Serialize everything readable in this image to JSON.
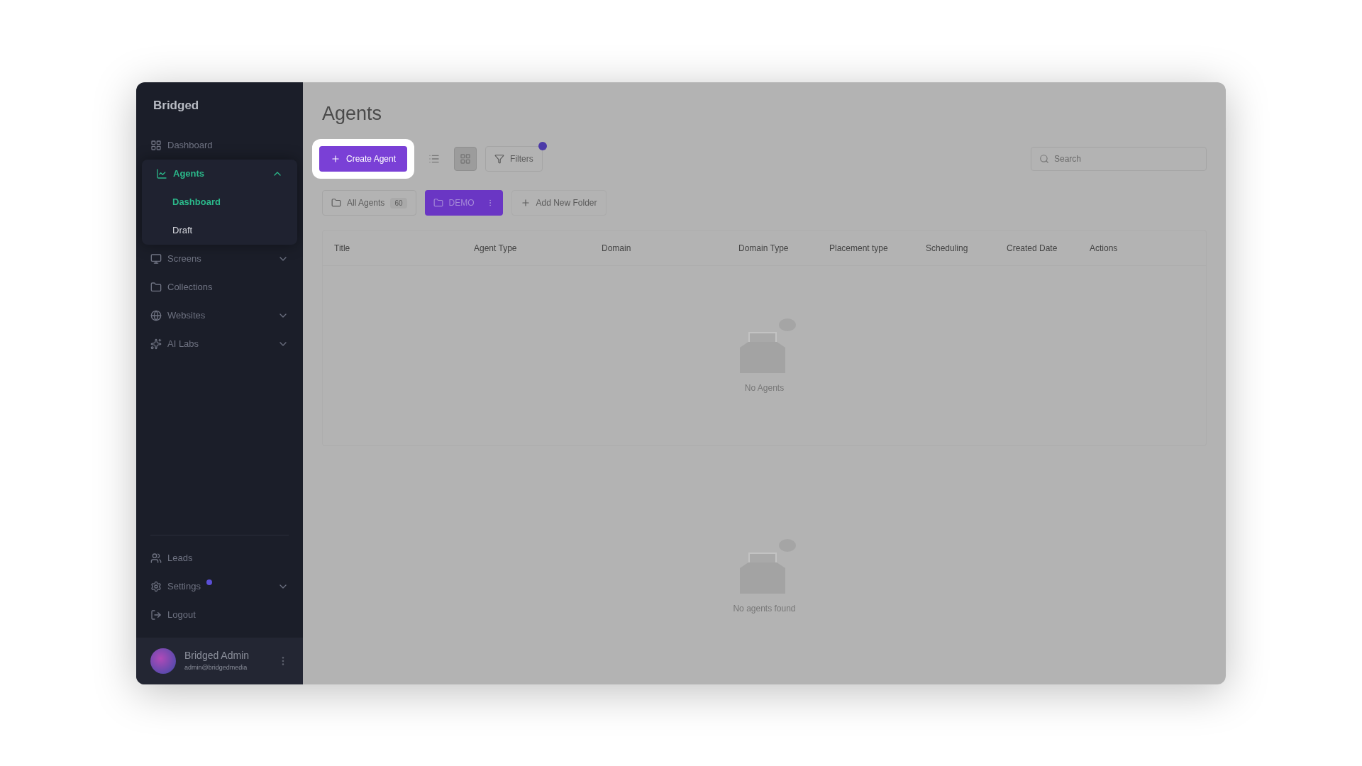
{
  "brand": "Bridged",
  "sidebar": {
    "items": [
      {
        "label": "Dashboard",
        "selected": false
      },
      {
        "label": "Agents",
        "selected": true,
        "expanded": true,
        "children": [
          {
            "label": "Dashboard",
            "selected": true
          },
          {
            "label": "Draft",
            "selected": false
          }
        ]
      },
      {
        "label": "Screens",
        "selected": false,
        "expanded": false
      },
      {
        "label": "Collections",
        "selected": false
      },
      {
        "label": "Websites",
        "selected": false,
        "expanded": false
      },
      {
        "label": "AI Labs",
        "selected": false,
        "expanded": false
      }
    ],
    "bottom_items": [
      {
        "label": "Leads",
        "badge": false
      },
      {
        "label": "Settings",
        "badge": true,
        "expanded": false
      },
      {
        "label": "Logout",
        "badge": false
      }
    ]
  },
  "user": {
    "name": "Bridged Admin",
    "email": "admin@bridgedmedia"
  },
  "page": {
    "title": "Agents",
    "create_button": "Create Agent",
    "view_modes": [
      {
        "kind": "list",
        "selected": false
      },
      {
        "kind": "grid",
        "selected": true
      }
    ],
    "filters": {
      "label": "Filters",
      "badge": true
    },
    "search": {
      "placeholder": "Search"
    },
    "folders": [
      {
        "label": "All Agents",
        "count": "60",
        "selected": false
      },
      {
        "label": "DEMO",
        "selected": true
      }
    ],
    "add_folder": "Add New Folder",
    "table": {
      "columns": [
        "Title",
        "Agent Type",
        "Domain",
        "Domain Type",
        "Placement type",
        "Scheduling",
        "Created Date",
        "Actions"
      ],
      "empty": "No Agents"
    },
    "empty_message": "No agents found"
  }
}
